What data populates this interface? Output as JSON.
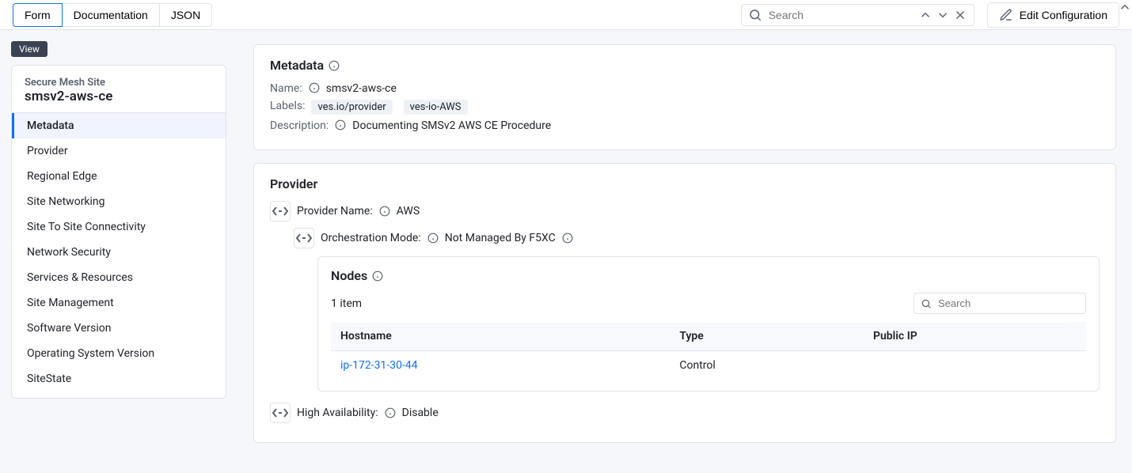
{
  "top": {
    "tabs": {
      "form": "Form",
      "documentation": "Documentation",
      "json": "JSON",
      "active": "form"
    },
    "search_placeholder": "Search",
    "edit_label": "Edit Configuration"
  },
  "sidebar": {
    "view_tag": "View",
    "title": "Secure Mesh Site",
    "name": "smsv2-aws-ce",
    "items": [
      {
        "id": "metadata",
        "label": "Metadata"
      },
      {
        "id": "provider",
        "label": "Provider"
      },
      {
        "id": "regional-edge",
        "label": "Regional Edge"
      },
      {
        "id": "site-networking",
        "label": "Site Networking"
      },
      {
        "id": "site-to-site",
        "label": "Site To Site Connectivity"
      },
      {
        "id": "network-security",
        "label": "Network Security"
      },
      {
        "id": "services-resources",
        "label": "Services & Resources"
      },
      {
        "id": "site-management",
        "label": "Site Management"
      },
      {
        "id": "software-version",
        "label": "Software Version"
      },
      {
        "id": "os-version",
        "label": "Operating System Version"
      },
      {
        "id": "sitestate",
        "label": "SiteState"
      }
    ],
    "active": "metadata"
  },
  "metadata": {
    "heading": "Metadata",
    "name_k": "Name:",
    "name_v": "smsv2-aws-ce",
    "labels_k": "Labels:",
    "labels": [
      "ves.io/provider",
      "ves-io-AWS"
    ],
    "description_k": "Description:",
    "description_v": "Documenting SMSv2 AWS CE Procedure"
  },
  "provider": {
    "heading": "Provider",
    "provider_name_k": "Provider Name:",
    "provider_name_v": "AWS",
    "orch_k": "Orchestration Mode:",
    "orch_v": "Not Managed By F5XC",
    "ha_k": "High Availability:",
    "ha_v": "Disable",
    "nodes": {
      "heading": "Nodes",
      "count_label": "1 item",
      "search_placeholder": "Search",
      "columns": {
        "hostname": "Hostname",
        "type": "Type",
        "public_ip": "Public IP"
      },
      "rows": [
        {
          "hostname": "ip-172-31-30-44",
          "type": "Control",
          "public_ip": ""
        }
      ]
    }
  }
}
